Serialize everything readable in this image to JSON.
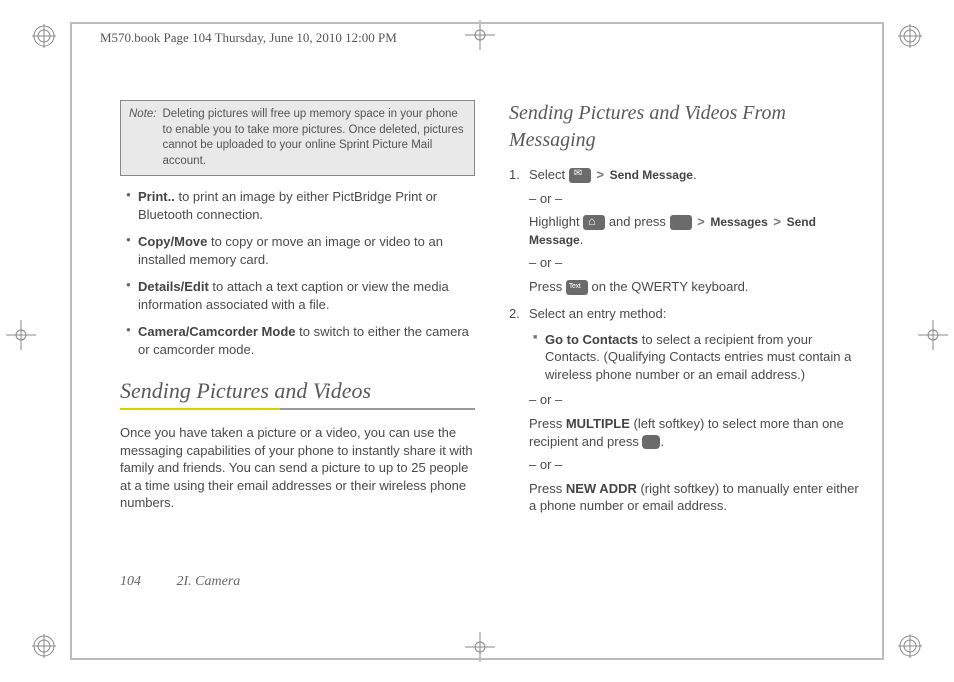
{
  "meta_header": "M570.book  Page 104  Thursday, June 10, 2010  12:00 PM",
  "note": {
    "label": "Note:",
    "text": "Deleting pictures will free up memory space in your phone to enable you to take more pictures. Once deleted, pictures cannot be uploaded to your online Sprint Picture Mail account."
  },
  "col1_bullets": [
    {
      "lead": "Print..",
      "rest": " to print an image by either PictBridge Print or Bluetooth connection."
    },
    {
      "lead": "Copy/Move",
      "rest": " to copy or move an image or video to an installed memory card."
    },
    {
      "lead": "Details/Edit",
      "rest": " to attach a text caption or view the media information associated with a file."
    },
    {
      "lead": "Camera/Camcorder Mode",
      "rest": " to switch to either the camera or camcorder mode."
    }
  ],
  "section1": {
    "title": "Sending Pictures and Videos",
    "body": "Once you have taken a picture or a video, you can use the messaging capabilities of your phone to instantly share it with family and friends. You can send a picture to up to 25 people at a time using their email addresses or their wireless phone numbers."
  },
  "section2": {
    "title": "Sending Pictures and Videos From Messaging"
  },
  "steps": {
    "s1": {
      "select_word": "Select ",
      "send_message": "Send Message",
      "period": ".",
      "or": "– or –",
      "highlight": "Highlight ",
      "and_press": " and press ",
      "messages": "Messages",
      "send": "Send Message",
      "press_word": "Press ",
      "qwerty_tail": " on the QWERTY keyboard."
    },
    "s2": {
      "head": "Select an entry method:",
      "sub_lead": "Go to Contacts",
      "sub_rest": " to select a recipient from your Contacts. (Qualifying Contacts entries must contain a wireless phone number or an email address.)",
      "or": "– or –",
      "multiple_pre": "Press ",
      "multiple": "MULTIPLE",
      "multiple_mid": " (left softkey) to select more than one recipient and press ",
      "multiple_end": ".",
      "newaddr_pre": "Press ",
      "newaddr": "NEW ADDR",
      "newaddr_rest": " (right softkey) to manually enter either a phone number or email address."
    }
  },
  "footer": {
    "page": "104",
    "section": "2I. Camera"
  }
}
